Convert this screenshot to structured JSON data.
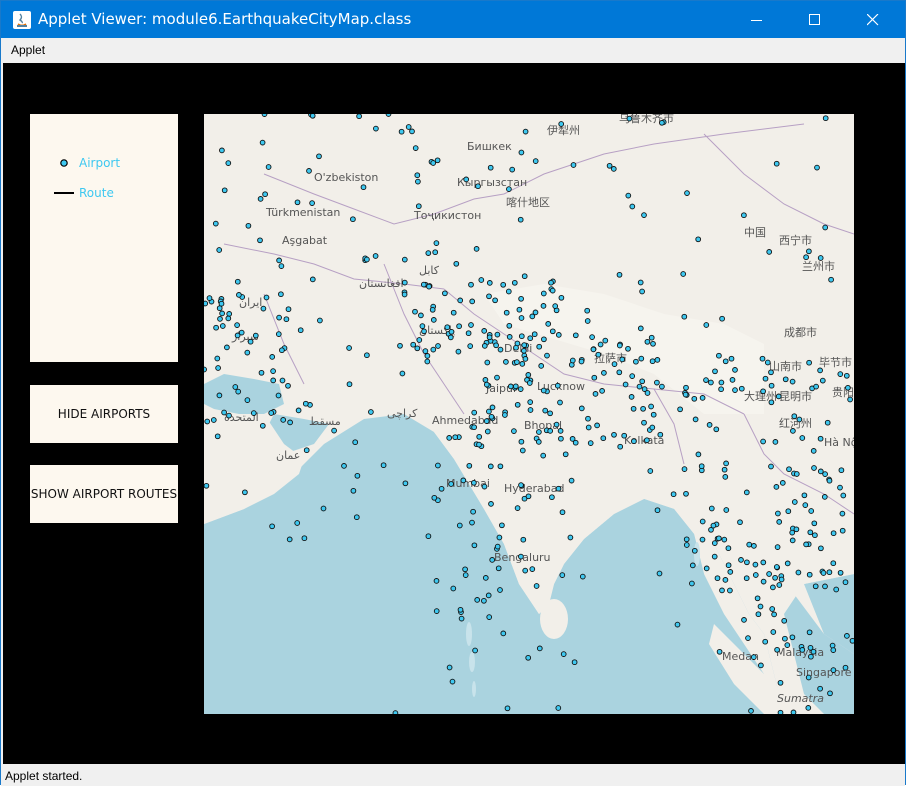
{
  "window": {
    "title": "Applet Viewer: module6.EarthquakeCityMap.class",
    "icons": {
      "app": "java-icon",
      "minimize": "minimize-icon",
      "maximize": "maximize-icon",
      "close": "close-icon"
    }
  },
  "menubar": {
    "items": [
      {
        "label": "Applet"
      }
    ]
  },
  "legend": {
    "airport_label": "Airport",
    "route_label": "Route",
    "label_color": "#3ec8f0"
  },
  "buttons": {
    "hide_airports": "HIDE AIRPORTS",
    "show_routes": "SHOW AIRPORT ROUTES"
  },
  "map": {
    "airport_color": "#3ec8f0",
    "labels": {
      "uzbekiston": "O'zbekiston",
      "turkmenistan": "Türkmenistan",
      "asgabat": "Aşgabat",
      "bishkek": "Бишкек",
      "kyrgyzstan": "Кыргызстан",
      "tojikiston": "Тоҷикистон",
      "kashgar": "喀什地区",
      "yining": "伊犁州",
      "urumqi": "乌鲁木齐市",
      "china": "中国",
      "xining": "西宁市",
      "lanzhou": "兰州市",
      "chengdu": "成都市",
      "kabul": "کابل",
      "afghanistan": "افغانستان",
      "iran": "ایران",
      "shiraz": "شیراز",
      "pakistan": "پاکستان",
      "delhi": "Delhi",
      "jaipur": "Jaipur",
      "lucknow": "Lucknow",
      "ahmedabad": "Ahmedabad",
      "karachi": "کراچی",
      "bhopal": "Bhopal",
      "kolkata": "Kolkata",
      "mumbai": "Mumbai",
      "hyderabad": "Hyderabad",
      "bengaluru": "Bengaluru",
      "muscat": "مسقط",
      "oman": "عمان",
      "uae": "المتحدة",
      "kunming": "昆明市",
      "honghe": "红河州",
      "hanoi": "Hà Nội",
      "medan": "Medan",
      "malaysia": "Malaysia",
      "singapore": "Singapore",
      "sumatra": "Sumatra",
      "lhasa": "拉萨市",
      "shannan": "山南市",
      "dali": "大理州",
      "bijie": "毕节市",
      "guiyang": "贵阳市"
    }
  },
  "status": {
    "text": "Applet started."
  }
}
